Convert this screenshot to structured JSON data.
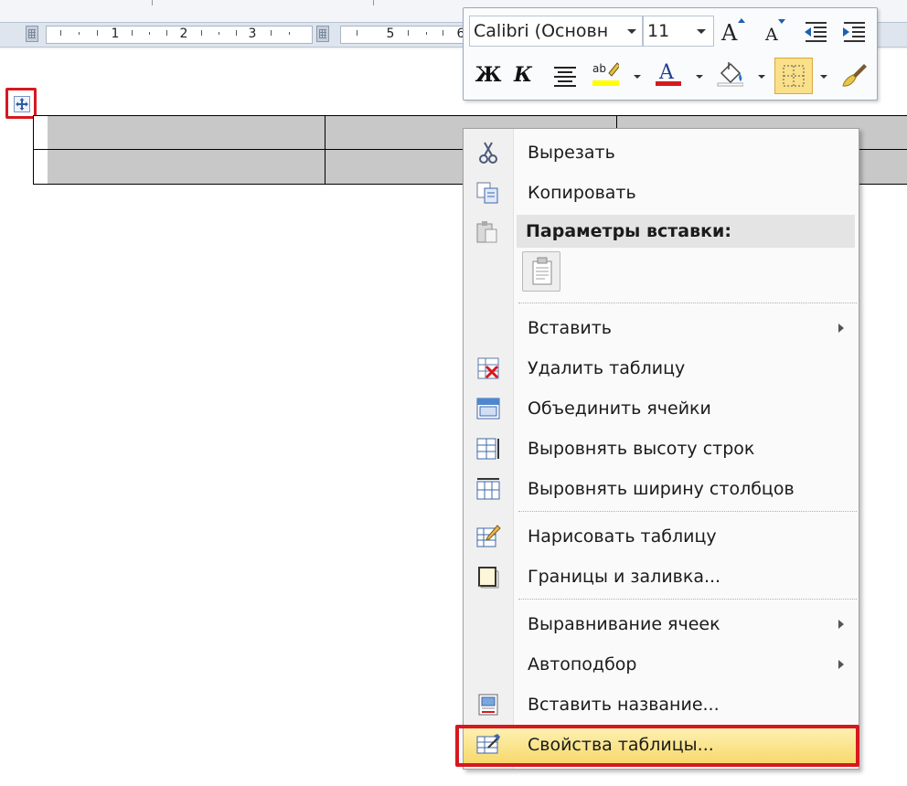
{
  "ruler": {
    "numbers": [
      "1",
      "2",
      "3",
      "5",
      "6"
    ]
  },
  "mini_toolbar": {
    "font_name": "Calibri (Основн",
    "font_size": "11",
    "bold_label": "Ж",
    "italic_label": "К",
    "highlight_color": "#ffff00",
    "font_color": "#d6191f"
  },
  "context_menu": {
    "cut": "Вырезать",
    "copy": "Копировать",
    "paste_options": "Параметры вставки:",
    "insert": "Вставить",
    "delete_table": "Удалить таблицу",
    "merge_cells": "Объединить ячейки",
    "distribute_rows": "Выровнять высоту строк",
    "distribute_columns": "Выровнять ширину столбцов",
    "draw_table": "Нарисовать таблицу",
    "borders_shading": "Границы и заливка...",
    "cell_alignment": "Выравнивание ячеек",
    "autofit": "Автоподбор",
    "insert_caption": "Вставить название...",
    "table_properties": "Свойства таблицы..."
  },
  "colors": {
    "highlight_frame": "#d6191f"
  }
}
